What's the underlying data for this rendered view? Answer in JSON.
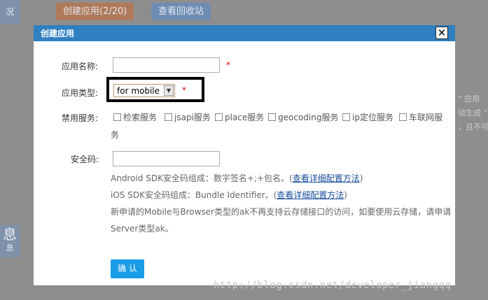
{
  "background": {
    "left_tab_top": "况",
    "left_tab_bottom_big": "息",
    "left_tab_bottom_small": "息",
    "create_app_button": "创建应用(2/20)",
    "recycle_bin_button": "查看回收站",
    "right_snippets": [
      "“ 应用",
      "动生成 “应",
      "，且不可"
    ]
  },
  "dialog": {
    "title": "创建应用",
    "close_glyph": "✕",
    "app_name_label": "应用名称:",
    "app_name_value": "",
    "app_type_label": "应用类型:",
    "app_type_selected": "for mobile",
    "disabled_services_label": "禁用服务:",
    "services": [
      "检索服务",
      "jsapi服务",
      "place服务",
      "geocoding服务",
      "ip定位服务",
      "车联网服"
    ],
    "services_wrap": "务",
    "security_code_label": "安全码:",
    "security_code_value": "",
    "hint_android_prefix": "Android SDK安全码组成：数字签名+;+包名。(",
    "hint_android_link": "查看详细配置方法",
    "hint_android_suffix": ")",
    "hint_ios_prefix": "iOS SDK安全码组成：Bundle Identifier。(",
    "hint_ios_link": "查看详细配置方法",
    "hint_ios_suffix": ")",
    "hint_notice_line1": "新申请的Mobile与Browser类型的ak不再支持云存储接口的访问，如要使用云存储，请申请",
    "hint_notice_line2": "Server类型ak。",
    "required_mark": "*",
    "confirm_button": "确 认"
  },
  "watermark": "http://blog.csdn.net/developer_jiangqq"
}
